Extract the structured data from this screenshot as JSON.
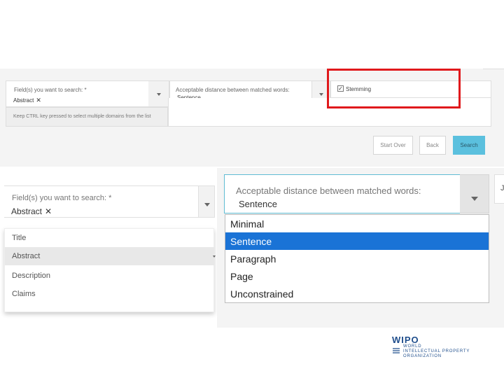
{
  "top": {
    "fields_label": "Field(s) you want to search: *",
    "fields_chip": "Abstract",
    "distance_label": "Acceptable distance between matched words:",
    "distance_value": "Sentence",
    "stemming_label": "Stemming",
    "help_text": "Keep CTRL key pressed to select multiple domains from the list",
    "buttons": {
      "start_over": "Start Over",
      "back": "Back",
      "search": "Search"
    },
    "search_color": "#5bc0de"
  },
  "fields_dropdown": {
    "label": "Field(s) you want to search: *",
    "chip": "Abstract",
    "options": [
      "Title",
      "Abstract",
      "Description",
      "Claims"
    ],
    "highlighted": "Abstract"
  },
  "distance_dropdown": {
    "label": "Acceptable distance between matched words:",
    "value": "Sentence",
    "side_glyph": "J",
    "options": [
      "Minimal",
      "Sentence",
      "Paragraph",
      "Page",
      "Unconstrained"
    ],
    "selected": "Sentence",
    "selected_color": "#1a73d6"
  },
  "logo": {
    "name": "WIPO",
    "line1": "WORLD",
    "line2": "INTELLECTUAL PROPERTY",
    "line3": "ORGANIZATION"
  },
  "highlight_color": "#e0191c"
}
